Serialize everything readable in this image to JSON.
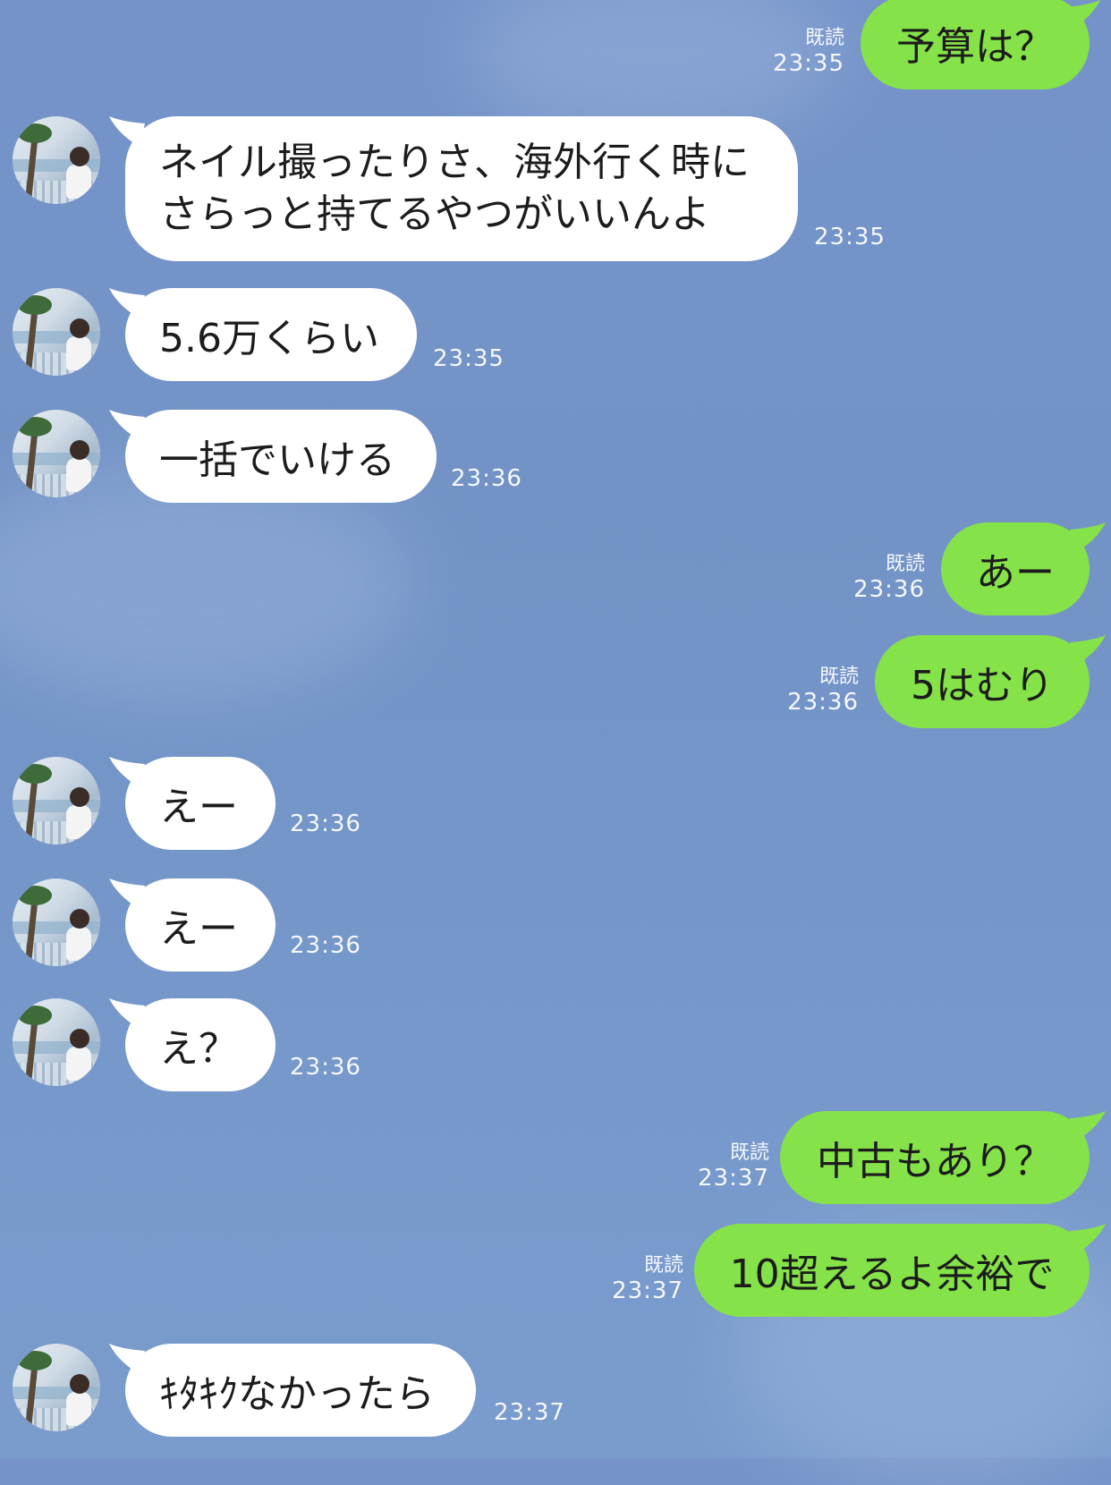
{
  "read_label": "既読",
  "messages": [
    {
      "dir": "out",
      "text": "予算は？",
      "time": "23:35"
    },
    {
      "dir": "in",
      "text": "ネイル撮ったりさ、海外行く時にさらっと持てるやつがいいんよ",
      "line1": "ネイル撮ったりさ、海外行く時に",
      "line2": "さらっと持てるやつがいいんよ",
      "time": "23:35"
    },
    {
      "dir": "in",
      "text": "5.6万くらい",
      "time": "23:35"
    },
    {
      "dir": "in",
      "text": "一括でいける",
      "time": "23:36"
    },
    {
      "dir": "out",
      "text": "あー",
      "time": "23:36"
    },
    {
      "dir": "out",
      "text": "5はむり",
      "time": "23:36"
    },
    {
      "dir": "in",
      "text": "えー",
      "time": "23:36"
    },
    {
      "dir": "in",
      "text": "えー",
      "time": "23:36"
    },
    {
      "dir": "in",
      "text": "え？",
      "time": "23:36"
    },
    {
      "dir": "out",
      "text": "中古もあり？",
      "time": "23:37"
    },
    {
      "dir": "out",
      "text": "10超えるよ余裕で",
      "time": "23:37"
    },
    {
      "dir": "in",
      "text": "ｷﾀｷｸなかったら",
      "time": "23:37"
    }
  ],
  "colors": {
    "outgoing_bubble": "#85e249",
    "incoming_bubble": "#ffffff",
    "background": "#7594c8",
    "meta_text": "#f5f8ff"
  }
}
